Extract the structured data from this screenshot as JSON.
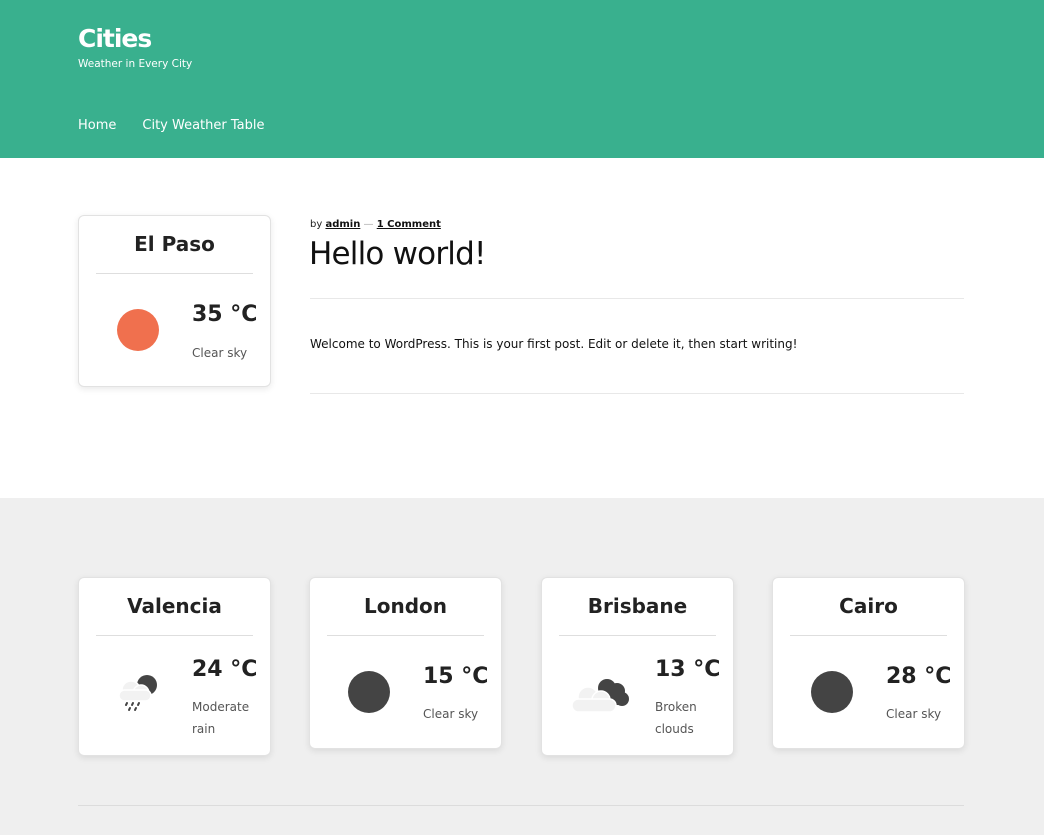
{
  "site": {
    "title": "Cities",
    "tagline": "Weather in Every City"
  },
  "nav": {
    "items": [
      "Home",
      "City Weather Table"
    ]
  },
  "sidebar_widget": {
    "city": "El Paso",
    "temp": "35 °C",
    "desc": "Clear sky",
    "icon": "sun-icon",
    "icon_color": "#f0704e"
  },
  "post": {
    "by": "by",
    "author": "admin",
    "separator": "—",
    "comments": "1 Comment",
    "title": "Hello world!",
    "body": "Welcome to WordPress. This is your first post. Edit or delete it, then start writing!"
  },
  "footer_widgets": [
    {
      "city": "Valencia",
      "temp": "24 °C",
      "desc": "Moderate rain",
      "icon": "rain-cloud-icon"
    },
    {
      "city": "London",
      "temp": "15 °C",
      "desc": "Clear sky",
      "icon": "moon-icon"
    },
    {
      "city": "Brisbane",
      "temp": "13 °C",
      "desc": "Broken clouds",
      "icon": "broken-clouds-icon"
    },
    {
      "city": "Cairo",
      "temp": "28 °C",
      "desc": "Clear sky",
      "icon": "moon-icon"
    }
  ],
  "colors": {
    "header_bg": "#39b08e",
    "footer_bg": "#efefef",
    "night_icon": "#444444"
  }
}
